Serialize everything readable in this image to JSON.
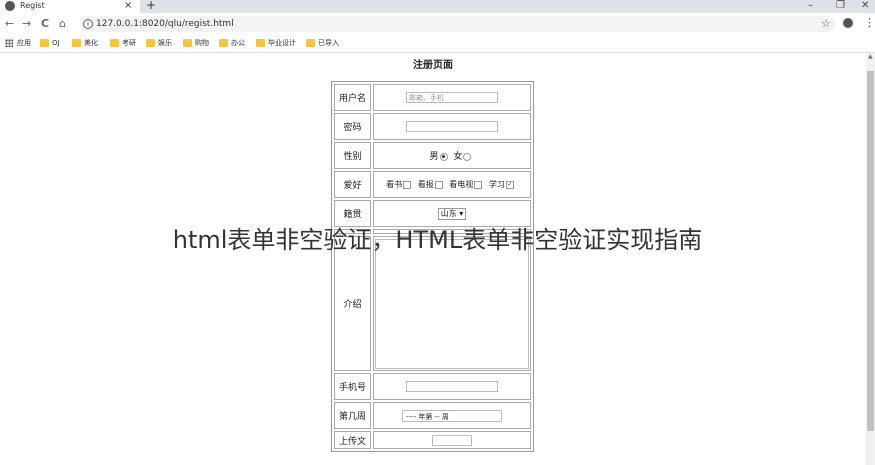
{
  "tab": {
    "title": "Regist",
    "close": "×",
    "new": "+"
  },
  "window": {
    "minimize": "–",
    "maximize": "❐",
    "close": "✕"
  },
  "toolbar": {
    "back": "←",
    "forward": "→",
    "reload": "C",
    "home": "⌂",
    "info": "i",
    "url": "127.0.0.1:8020/qlu/regist.html",
    "star": "☆",
    "menu": "⋮"
  },
  "bookmarks": [
    "应用",
    "OJ",
    "美化",
    "考研",
    "娱乐",
    "购物",
    "办公",
    "毕业设计",
    "已导入"
  ],
  "page": {
    "title": "注册页面"
  },
  "form": {
    "username": {
      "label": "用户名",
      "placeholder": "邮箱、手机"
    },
    "password": {
      "label": "密码"
    },
    "gender": {
      "label": "性别",
      "male": "男",
      "female": "女"
    },
    "hobby": {
      "label": "爱好",
      "items": [
        "看书",
        "看报",
        "看电视",
        "学习"
      ]
    },
    "origin": {
      "label": "籍贯",
      "selected": "山东"
    },
    "intro": {
      "label": "介绍"
    },
    "phone": {
      "label": "手机号"
    },
    "week": {
      "label": "第几周",
      "placeholder": "---- 年第 -- 周"
    },
    "upload": {
      "label": "上传文"
    }
  },
  "overlay": {
    "text": "html表单非空验证，HTML表单非空验证实现指南"
  }
}
